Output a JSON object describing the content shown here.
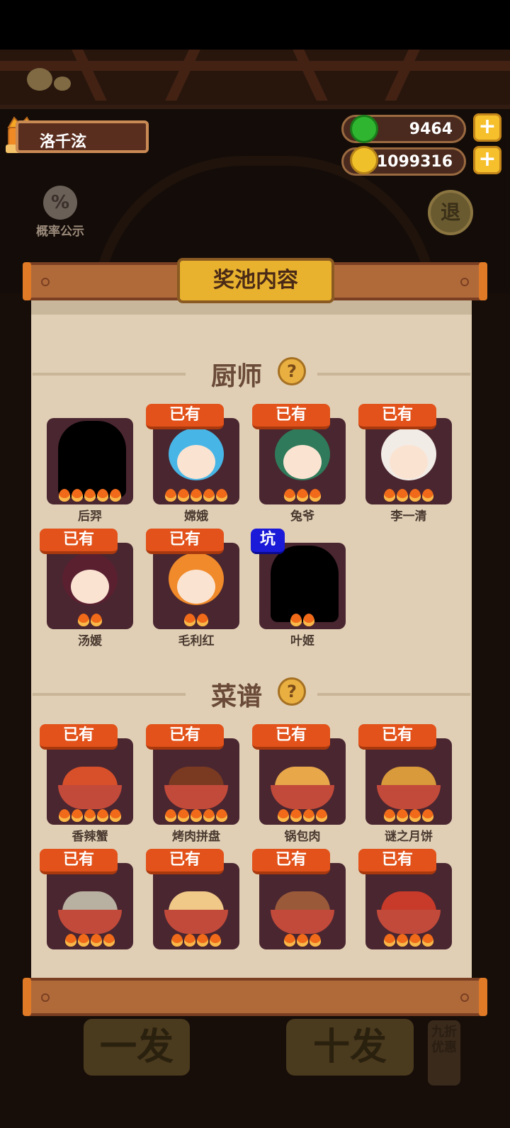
{
  "player": {
    "name": "洛千泫"
  },
  "resources": {
    "jade": {
      "value": "9464",
      "icon": "jade-coin-icon"
    },
    "gold": {
      "value": "1099316",
      "icon": "gold-coin-icon"
    },
    "plus_symbol": "+"
  },
  "odds": {
    "label": "概率公示",
    "icon_glyph": "%"
  },
  "back": {
    "label": "退"
  },
  "panel": {
    "title": "奖池内容"
  },
  "chefs": {
    "title": "厨师",
    "help_glyph": "?",
    "items": [
      {
        "name": "后羿",
        "badge": "",
        "flames": 5,
        "silhouette": true
      },
      {
        "name": "嫦娥",
        "badge": "已有",
        "flames": 5,
        "silhouette": false,
        "color": "#47b6e6"
      },
      {
        "name": "兔爷",
        "badge": "已有",
        "flames": 3,
        "silhouette": false,
        "color": "#2f7a5a"
      },
      {
        "name": "李一清",
        "badge": "已有",
        "flames": 4,
        "silhouette": false,
        "color": "#f2ece6"
      },
      {
        "name": "汤媛",
        "badge": "已有",
        "flames": 2,
        "silhouette": false,
        "color": "#5a2030"
      },
      {
        "name": "毛利红",
        "badge": "已有",
        "flames": 2,
        "silhouette": false,
        "color": "#f08a2a"
      },
      {
        "name": "叶姬",
        "badge": "坑",
        "flames": 2,
        "silhouette": true
      }
    ]
  },
  "recipes": {
    "title": "菜谱",
    "help_glyph": "?",
    "items": [
      {
        "name": "香辣蟹",
        "badge": "已有",
        "flames": 5,
        "color": "#d8502a"
      },
      {
        "name": "烤肉拼盘",
        "badge": "已有",
        "flames": 5,
        "color": "#7a3a22"
      },
      {
        "name": "锅包肉",
        "badge": "已有",
        "flames": 4,
        "color": "#e8a84a"
      },
      {
        "name": "谜之月饼",
        "badge": "已有",
        "flames": 4,
        "color": "#d89a3a"
      },
      {
        "name": "",
        "badge": "已有",
        "flames": 4,
        "color": "#b8b0a0"
      },
      {
        "name": "",
        "badge": "已有",
        "flames": 4,
        "color": "#f0c888"
      },
      {
        "name": "",
        "badge": "已有",
        "flames": 3,
        "color": "#9a5a3a"
      },
      {
        "name": "",
        "badge": "已有",
        "flames": 4,
        "color": "#c83a2a"
      }
    ]
  },
  "bottom": {
    "single": "一发",
    "ten": "十发",
    "discount": "九折优惠"
  }
}
